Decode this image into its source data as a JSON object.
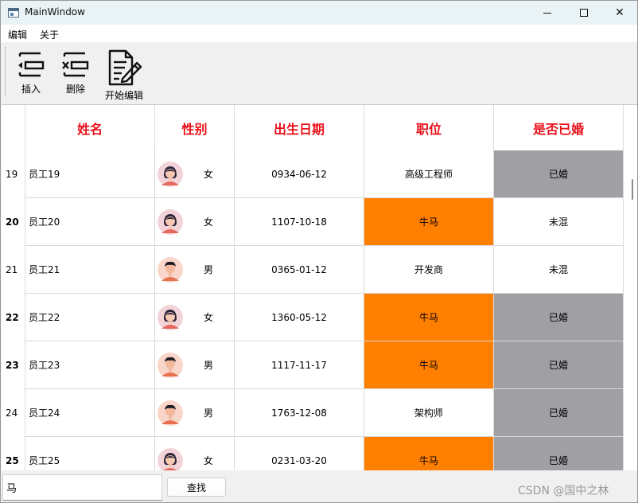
{
  "window": {
    "title": "MainWindow"
  },
  "menu": {
    "items": [
      "编辑",
      "关于"
    ]
  },
  "toolbar": {
    "insert_label": "插入",
    "delete_label": "删除",
    "edit_label": "开始编辑"
  },
  "table": {
    "columns": [
      "姓名",
      "性别",
      "出生日期",
      "职位",
      "是否已婚"
    ],
    "header_color": "#e8101a",
    "highlight_colors": {
      "orange": "#ff7f00",
      "gray": "#a09fa4"
    },
    "rows": [
      {
        "num": "19",
        "name": "员工19",
        "gender": "女",
        "avatar": "female-avatar-icon",
        "birth": "0934-06-12",
        "position": "高级工程师",
        "married": "已婚",
        "pos_hl": false,
        "mar_hl": true,
        "bold": false
      },
      {
        "num": "20",
        "name": "员工20",
        "gender": "女",
        "avatar": "female-avatar-icon",
        "birth": "1107-10-18",
        "position": "牛马",
        "married": "未混",
        "pos_hl": true,
        "mar_hl": false,
        "bold": true
      },
      {
        "num": "21",
        "name": "员工21",
        "gender": "男",
        "avatar": "male-avatar-icon",
        "birth": "0365-01-12",
        "position": "开发商",
        "married": "未混",
        "pos_hl": false,
        "mar_hl": false,
        "bold": false
      },
      {
        "num": "22",
        "name": "员工22",
        "gender": "女",
        "avatar": "female-avatar-icon",
        "birth": "1360-05-12",
        "position": "牛马",
        "married": "已婚",
        "pos_hl": true,
        "mar_hl": true,
        "bold": true
      },
      {
        "num": "23",
        "name": "员工23",
        "gender": "男",
        "avatar": "male-avatar-icon",
        "birth": "1117-11-17",
        "position": "牛马",
        "married": "已婚",
        "pos_hl": true,
        "mar_hl": true,
        "bold": true
      },
      {
        "num": "24",
        "name": "员工24",
        "gender": "男",
        "avatar": "male-avatar-icon",
        "birth": "1763-12-08",
        "position": "架构师",
        "married": "已婚",
        "pos_hl": false,
        "mar_hl": true,
        "bold": false
      },
      {
        "num": "25",
        "name": "员工25",
        "gender": "女",
        "avatar": "female-avatar-icon",
        "birth": "0231-03-20",
        "position": "牛马",
        "married": "已婚",
        "pos_hl": true,
        "mar_hl": true,
        "bold": true
      }
    ]
  },
  "search": {
    "value": "马",
    "button_label": "查找"
  },
  "watermark": "CSDN @国中之林"
}
